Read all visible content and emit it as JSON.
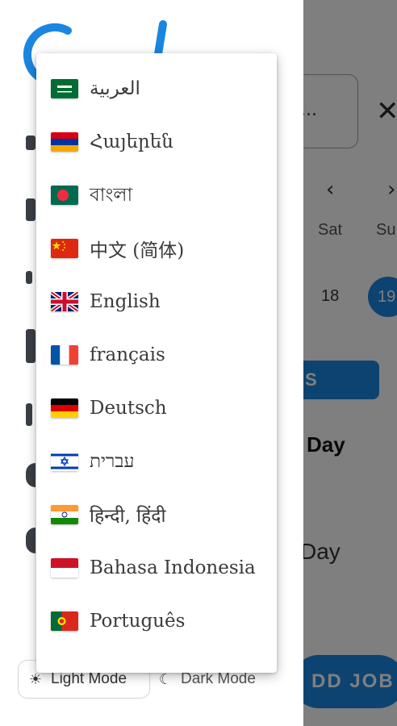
{
  "background_app": {
    "search_placeholder": "...",
    "close_glyph": "✕",
    "prev_chevron": "‹",
    "next_chevron": "›",
    "days": [
      "Sat",
      "Su"
    ],
    "dates": [
      "18",
      "19"
    ],
    "blue_bar_text": "S",
    "heading_1": "Day",
    "heading_2": "Day",
    "add_job_label": "DD JOB"
  },
  "drawer": {
    "logo_letters": "G l",
    "theme": {
      "light_label": "Light Mode",
      "dark_label": "Dark Mode",
      "light_icon": "sun-icon",
      "dark_icon": "moon-icon",
      "selected": "light"
    }
  },
  "language_menu": {
    "items": [
      {
        "label": "العربية",
        "flag": "saudi-arabia"
      },
      {
        "label": "Հայերեն",
        "flag": "armenia"
      },
      {
        "label": "বাংলা",
        "flag": "bangladesh"
      },
      {
        "label": "中文 (简体)",
        "flag": "china"
      },
      {
        "label": "English",
        "flag": "united-kingdom"
      },
      {
        "label": "français",
        "flag": "france"
      },
      {
        "label": "Deutsch",
        "flag": "germany"
      },
      {
        "label": "עברית",
        "flag": "israel"
      },
      {
        "label": "हिन्दी, हिंदी",
        "flag": "india"
      },
      {
        "label": "Bahasa Indonesia",
        "flag": "indonesia"
      },
      {
        "label": "Português",
        "flag": "portugal"
      }
    ]
  },
  "colors": {
    "accent": "#1a86e0",
    "menu_text": "#3a3a3a",
    "scrim": "rgba(0,0,0,0.5)"
  }
}
